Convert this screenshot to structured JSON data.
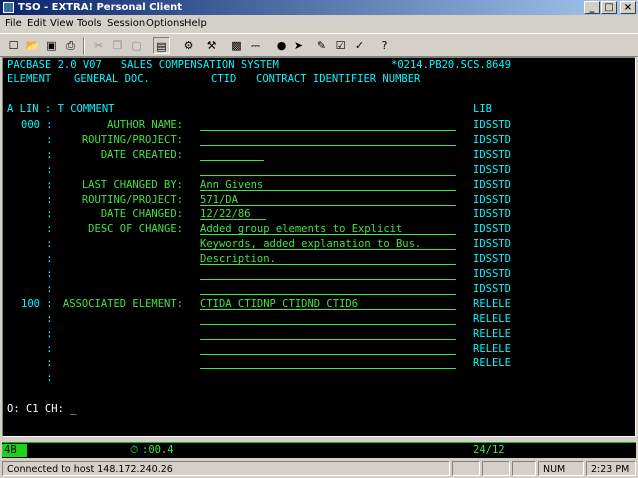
{
  "window": {
    "title": "TSO - EXTRA! Personal Client",
    "min_label": "_",
    "max_label": "□",
    "close_label": "×"
  },
  "menu": [
    "File",
    "Edit",
    "View",
    "Tools",
    "Session",
    "Options",
    "Help"
  ],
  "toolbar_icons": [
    "new-icon",
    "open-icon",
    "save-icon",
    "print-icon",
    "cut-icon",
    "copy-icon",
    "paste-icon",
    "screen-icon",
    "settings-icon",
    "tools-icon",
    "host-icon",
    "disconnect-icon",
    "connect-icon",
    "macro-play-icon",
    "record-icon",
    "edit-icon",
    "run-icon",
    "help-icon"
  ],
  "terminal": {
    "header1": {
      "left": "PACBASE 2.0 V07   SALES COMPENSATION SYSTEM",
      "right": "*0214.PB20.SCS.8649"
    },
    "header2": {
      "element": "ELEMENT",
      "general": "GENERAL DOC.",
      "code": "CTID",
      "desc": "CONTRACT IDENTIFIER NUMBER"
    },
    "col_header": {
      "left": "A LIN : T COMMENT",
      "lib": "LIB"
    },
    "rows": [
      {
        "lin": "000 :",
        "label": "AUTHOR NAME:",
        "value": "",
        "lib": "IDSSTD"
      },
      {
        "lin": "    :",
        "label": "ROUTING/PROJECT:",
        "value": "",
        "lib": "IDSSTD"
      },
      {
        "lin": "    :",
        "label": "DATE CREATED:",
        "value": "",
        "lib": "IDSSTD"
      },
      {
        "lin": "    :",
        "label": "",
        "value": "",
        "lib": "IDSSTD"
      },
      {
        "lin": "    :",
        "label": "LAST CHANGED BY:",
        "value": "Ann Givens",
        "lib": "IDSSTD"
      },
      {
        "lin": "    :",
        "label": "ROUTING/PROJECT:",
        "value": "571/DA",
        "lib": "IDSSTD"
      },
      {
        "lin": "    :",
        "label": "DATE CHANGED:",
        "value": "12/22/86",
        "lib": "IDSSTD"
      },
      {
        "lin": "    :",
        "label": "DESC OF CHANGE:",
        "value": "Added group elements to Explicit",
        "lib": "IDSSTD"
      },
      {
        "lin": "    :",
        "label": "",
        "value": "Keywords, added explanation to Bus.",
        "lib": "IDSSTD"
      },
      {
        "lin": "    :",
        "label": "",
        "value": "Description.",
        "lib": "IDSSTD"
      },
      {
        "lin": "    :",
        "label": "",
        "value": "",
        "lib": "IDSSTD"
      },
      {
        "lin": "    :",
        "label": "",
        "value": "",
        "lib": "IDSSTD"
      },
      {
        "lin": "100 :",
        "label": "ASSOCIATED ELEMENT:",
        "value": "CTIDA CTIDNP CTIDND CTID6",
        "lib": "RELELE"
      },
      {
        "lin": "    :",
        "label": "",
        "value": "",
        "lib": "RELELE"
      },
      {
        "lin": "    :",
        "label": "",
        "value": "",
        "lib": "RELELE"
      },
      {
        "lin": "    :",
        "label": "",
        "value": "",
        "lib": "RELELE"
      },
      {
        "lin": "    :",
        "label": "",
        "value": "",
        "lib": "RELELE"
      },
      {
        "lin": "    :",
        "label": "",
        "value": "",
        "lib": ""
      }
    ],
    "command_line": "O: C1 CH: _"
  },
  "oia": {
    "session": "4B",
    "timer": ":00.4",
    "cursor_pos": "24/12"
  },
  "statusbar": {
    "connection": "Connected to host 148.172.240.26",
    "num": "NUM",
    "time": "2:23 PM"
  },
  "colors": {
    "terminal_bg": "#000000",
    "cyan_text": "#0af5ff",
    "green_text": "#46e046",
    "underline": "#3fe64a",
    "title_gradient_start": "#0a246a"
  }
}
